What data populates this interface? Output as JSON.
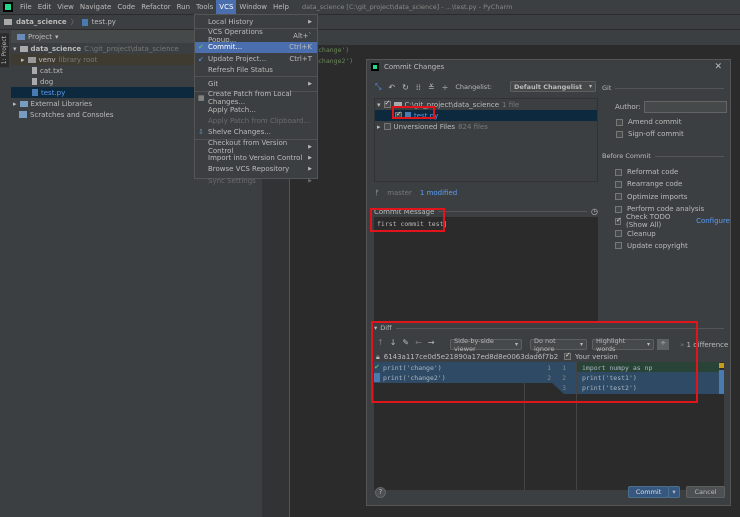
{
  "menubar": {
    "items": [
      "File",
      "Edit",
      "View",
      "Navigate",
      "Code",
      "Refactor",
      "Run",
      "Tools",
      "VCS",
      "Window",
      "Help"
    ],
    "title": "data_science [C:\\git_project\\data_science] - ...\\test.py - PyCharm"
  },
  "breadcrumb": {
    "project": "data_science",
    "file": "test.py"
  },
  "toolstrip": {
    "project_tab": "1: Project"
  },
  "project": {
    "header": "Project",
    "root": "data_science",
    "root_path": "C:\\git_project\\data_science",
    "venv": "venv",
    "venv_note": "library root",
    "files": [
      "cat.txt",
      "dog",
      "test.py"
    ],
    "external": "External Libraries",
    "scratches": "Scratches and Consoles"
  },
  "editor": {
    "lines": [
      "change')",
      "change2')"
    ]
  },
  "vcs_menu": {
    "items": [
      {
        "label": "Local History",
        "arrow": true
      },
      {
        "label": "VCS Operations Popup...",
        "shortcut": "Alt+`"
      },
      {
        "label": "Commit...",
        "shortcut": "Ctrl+K",
        "highlighted": true
      },
      {
        "label": "Update Project...",
        "shortcut": "Ctrl+T"
      },
      {
        "label": "Refresh File Status"
      },
      {
        "label": "Git",
        "arrow": true
      },
      {
        "label": "Create Patch from Local Changes..."
      },
      {
        "label": "Apply Patch..."
      },
      {
        "label": "Apply Patch from Clipboard...",
        "disabled": true
      },
      {
        "label": "Shelve Changes..."
      },
      {
        "label": "Checkout from Version Control",
        "arrow": true
      },
      {
        "label": "Import into Version Control",
        "arrow": true
      },
      {
        "label": "Browse VCS Repository",
        "arrow": true
      },
      {
        "label": "Sync Settings",
        "arrow": true,
        "disabled": true
      }
    ]
  },
  "dialog": {
    "title": "Commit Changes",
    "changelist_label": "Changelist:",
    "changelist": "Default Changelist",
    "tree": {
      "root": "C:\\git_project\\data_science",
      "root_count": "1 file",
      "file": "test.py",
      "unversioned": "Unversioned Files",
      "unversioned_count": "824 files"
    },
    "branch": "master",
    "modified": "1 modified",
    "commit_message_label": "Commit Message",
    "commit_message": "first commit test",
    "git_section": "Git",
    "author_label": "Author:",
    "author_value": "",
    "amend": "Amend commit",
    "signoff": "Sign-off commit",
    "before_commit": "Before Commit",
    "options": [
      {
        "label": "Reformat code",
        "checked": false
      },
      {
        "label": "Rearrange code",
        "checked": false
      },
      {
        "label": "Optimize imports",
        "checked": false
      },
      {
        "label": "Perform code analysis",
        "checked": false
      },
      {
        "label": "Check TODO (Show All)",
        "checked": true,
        "link": "Configure"
      },
      {
        "label": "Cleanup",
        "checked": false
      },
      {
        "label": "Update copyright",
        "checked": false
      }
    ],
    "diff": {
      "label": "Diff",
      "viewer": "Side-by-side viewer",
      "ignore": "Do not ignore",
      "highlight": "Highlight words",
      "differences": "1 difference",
      "left_hash": "6143a117ce0d5e21890a17ed8d8e0063dad6f7b2",
      "right_label": "Your version",
      "left_lines": [
        "print('change')",
        "print('change2')"
      ],
      "right_lines": [
        "import numpy as np",
        "print('test1')",
        "print('test2')"
      ],
      "left_nums": [
        "1",
        "2"
      ],
      "right_nums": [
        "1",
        "2",
        "3"
      ]
    },
    "commit_button": "Commit",
    "cancel_button": "Cancel",
    "help": "?"
  },
  "colors": {
    "accent": "#4b6eaf",
    "highlight_box": "#e0151b",
    "selection": "#0d293e"
  }
}
